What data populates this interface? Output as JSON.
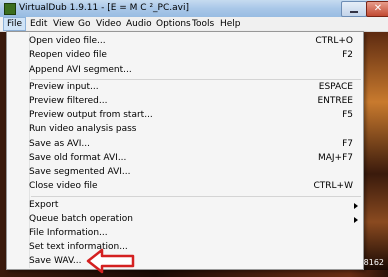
{
  "window": {
    "title": "VirtualDub 1.9.11 - [E = M C ²_PC.avi]",
    "close_label": "✕"
  },
  "menubar": {
    "items": [
      "File",
      "Edit",
      "View",
      "Go",
      "Video",
      "Audio",
      "Options",
      "Tools",
      "Help"
    ]
  },
  "file_menu": {
    "items": [
      {
        "label": "Open video file...",
        "shortcut": "CTRL+O"
      },
      {
        "label": "Reopen video file",
        "shortcut": "F2"
      },
      {
        "label": "Append AVI segment...",
        "shortcut": ""
      },
      {
        "label": "Preview input...",
        "shortcut": "ESPACE"
      },
      {
        "label": "Preview filtered...",
        "shortcut": "ENTREE"
      },
      {
        "label": "Preview output from start...",
        "shortcut": "F5"
      },
      {
        "label": "Run video analysis pass",
        "shortcut": ""
      },
      {
        "label": "Save as AVI...",
        "shortcut": "F7"
      },
      {
        "label": "Save old format AVI...",
        "shortcut": "MAJ+F7"
      },
      {
        "label": "Save segmented AVI...",
        "shortcut": ""
      },
      {
        "label": "Close video file",
        "shortcut": "CTRL+W"
      },
      {
        "label": "Export",
        "shortcut": ""
      },
      {
        "label": "Queue batch operation",
        "shortcut": ""
      },
      {
        "label": "File Information...",
        "shortcut": ""
      },
      {
        "label": "Set text information...",
        "shortcut": ""
      },
      {
        "label": "Save WAV...",
        "shortcut": ""
      }
    ]
  },
  "status": {
    "frame_fragment": "8162"
  },
  "colors": {
    "annotation_arrow": "#d42020",
    "menu_bg": "#f5f5f5",
    "titlebar": "#a9c7e8"
  }
}
